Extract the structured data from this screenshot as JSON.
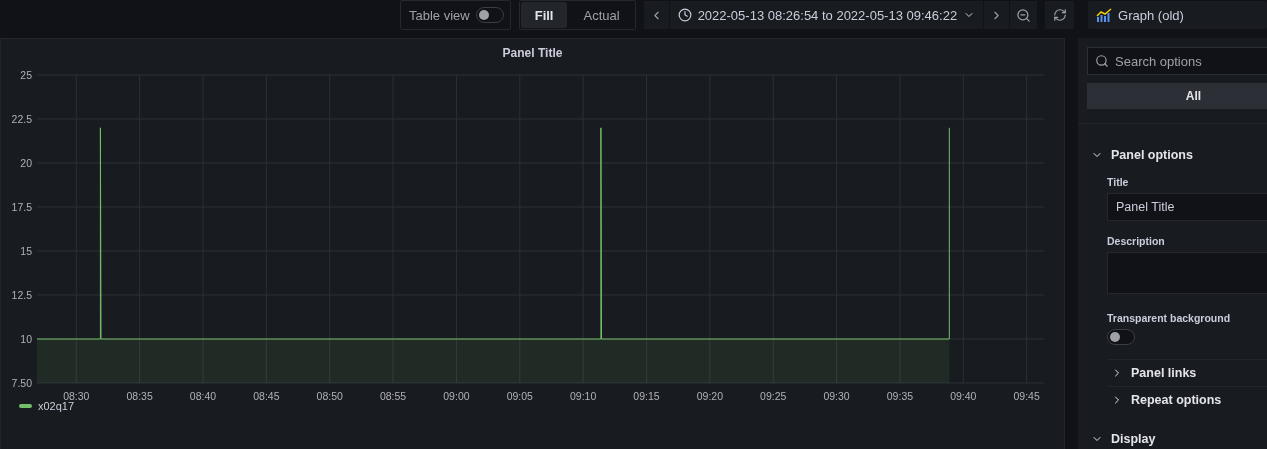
{
  "toolbar": {
    "table_view": {
      "label": "Table view",
      "on": false
    },
    "fill_modes": [
      {
        "label": "Fill",
        "selected": true
      },
      {
        "label": "Actual",
        "selected": false
      }
    ],
    "time_range": "2022-05-13 08:26:54 to 2022-05-13 09:46:22",
    "visualization": "Graph (old)"
  },
  "panel": {
    "title": "Panel Title",
    "chart_data": {
      "type": "area",
      "grid": true,
      "x": [
        506.9,
        511.9,
        511.9,
        511.95,
        551.4,
        551.4,
        551.45,
        578.9,
        578.9
      ],
      "series": [
        {
          "name": "x02q17",
          "color": "#73bf69",
          "values": [
            10,
            10,
            22,
            10,
            10,
            22,
            10,
            10,
            22
          ]
        }
      ],
      "xlim": [
        506.9,
        586.37
      ],
      "ylim": [
        7.5,
        25
      ],
      "xticks": [
        {
          "value": 510,
          "label": "08:30"
        },
        {
          "value": 515,
          "label": "08:35"
        },
        {
          "value": 520,
          "label": "08:40"
        },
        {
          "value": 525,
          "label": "08:45"
        },
        {
          "value": 530,
          "label": "08:50"
        },
        {
          "value": 535,
          "label": "08:55"
        },
        {
          "value": 540,
          "label": "09:00"
        },
        {
          "value": 545,
          "label": "09:05"
        },
        {
          "value": 550,
          "label": "09:10"
        },
        {
          "value": 555,
          "label": "09:15"
        },
        {
          "value": 560,
          "label": "09:20"
        },
        {
          "value": 565,
          "label": "09:25"
        },
        {
          "value": 570,
          "label": "09:30"
        },
        {
          "value": 575,
          "label": "09:35"
        },
        {
          "value": 580,
          "label": "09:40"
        },
        {
          "value": 585,
          "label": "09:45"
        }
      ],
      "yticks": [
        {
          "value": 7.5,
          "label": "7.50"
        },
        {
          "value": 10,
          "label": "10"
        },
        {
          "value": 12.5,
          "label": "12.5"
        },
        {
          "value": 15,
          "label": "15"
        },
        {
          "value": 17.5,
          "label": "17.5"
        },
        {
          "value": 20,
          "label": "20"
        },
        {
          "value": 22.5,
          "label": "22.5"
        },
        {
          "value": 25,
          "label": "25"
        }
      ]
    }
  },
  "options": {
    "search": {
      "placeholder": "Search options"
    },
    "filter": "All",
    "sections": [
      {
        "title": "Panel options",
        "expanded": true,
        "fields": [
          {
            "kind": "text",
            "label": "Title",
            "value": "Panel Title"
          },
          {
            "kind": "textarea",
            "label": "Description"
          },
          {
            "kind": "switch",
            "label": "Transparent background",
            "on": false
          }
        ],
        "subsections": [
          {
            "title": "Panel links",
            "expanded": false
          },
          {
            "title": "Repeat options",
            "expanded": false
          }
        ]
      },
      {
        "title": "Display",
        "expanded": true
      }
    ]
  }
}
